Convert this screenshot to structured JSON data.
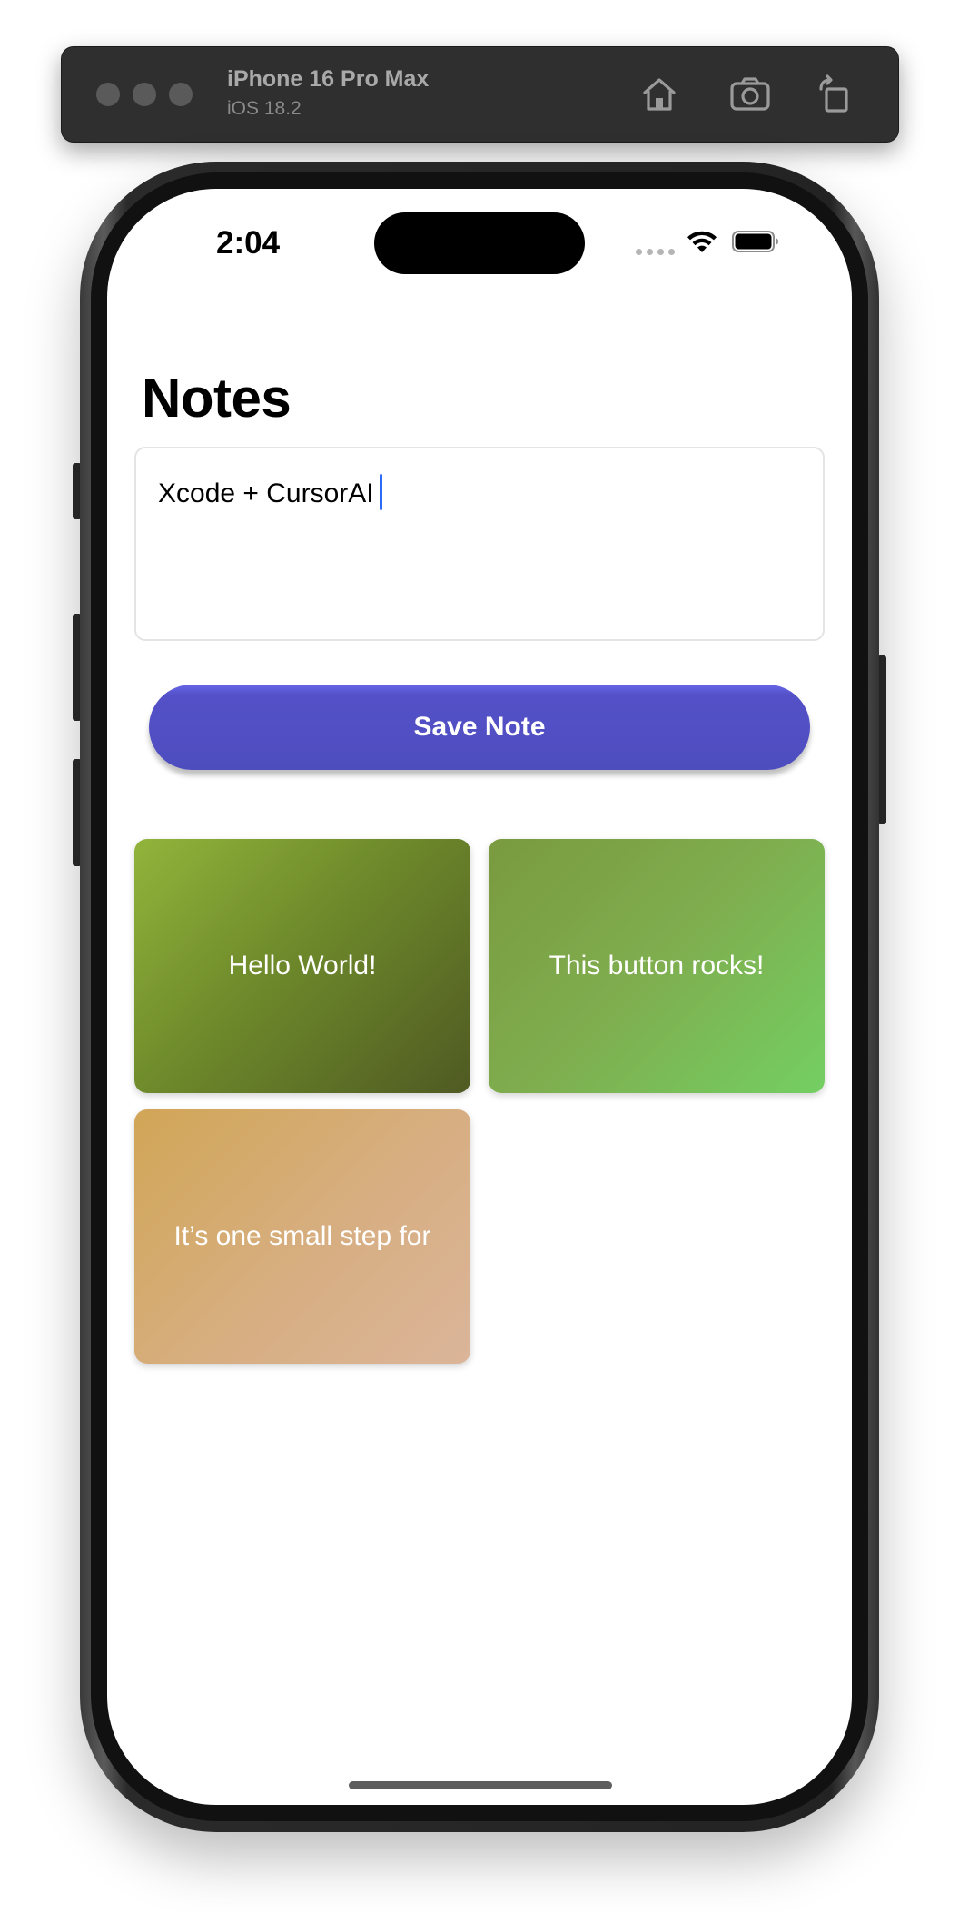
{
  "simulator": {
    "device_name": "iPhone 16 Pro Max",
    "os_version": "iOS 18.2",
    "icons": [
      "home-icon",
      "screenshot-camera-icon",
      "rotate-icon"
    ]
  },
  "status_bar": {
    "time": "2:04",
    "icons": [
      "cellular-signal-icon",
      "wifi-icon",
      "battery-icon"
    ]
  },
  "app": {
    "title": "Notes",
    "editor": {
      "value": "Xcode + CursorAI"
    },
    "save_button_label": "Save Note",
    "notes": [
      {
        "text": "Hello World!"
      },
      {
        "text": "This button rocks!"
      },
      {
        "text": "It’s one small step for"
      }
    ]
  },
  "colors": {
    "accent": "#5250C4",
    "caret": "#2B6CF6",
    "card_1": "#7A922F",
    "card_2": "#7DB553",
    "card_3": "#D6AE7E"
  }
}
